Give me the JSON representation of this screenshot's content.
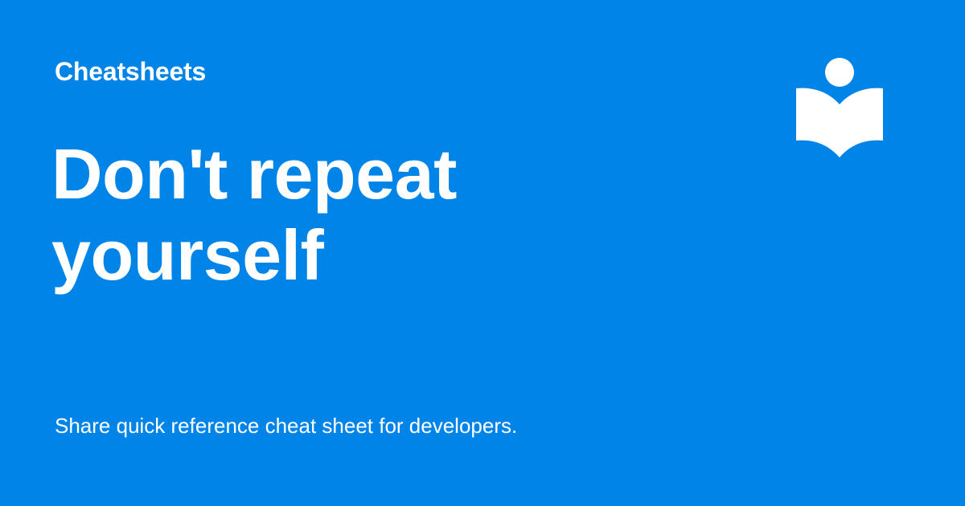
{
  "brand": {
    "name": "Cheatsheets",
    "logo_icon": "open-book-reader-icon"
  },
  "title": "Don't repeat yourself",
  "subtitle": "Share quick reference cheat sheet for developers.",
  "colors": {
    "background": "#0084e8",
    "foreground": "#ffffff"
  }
}
